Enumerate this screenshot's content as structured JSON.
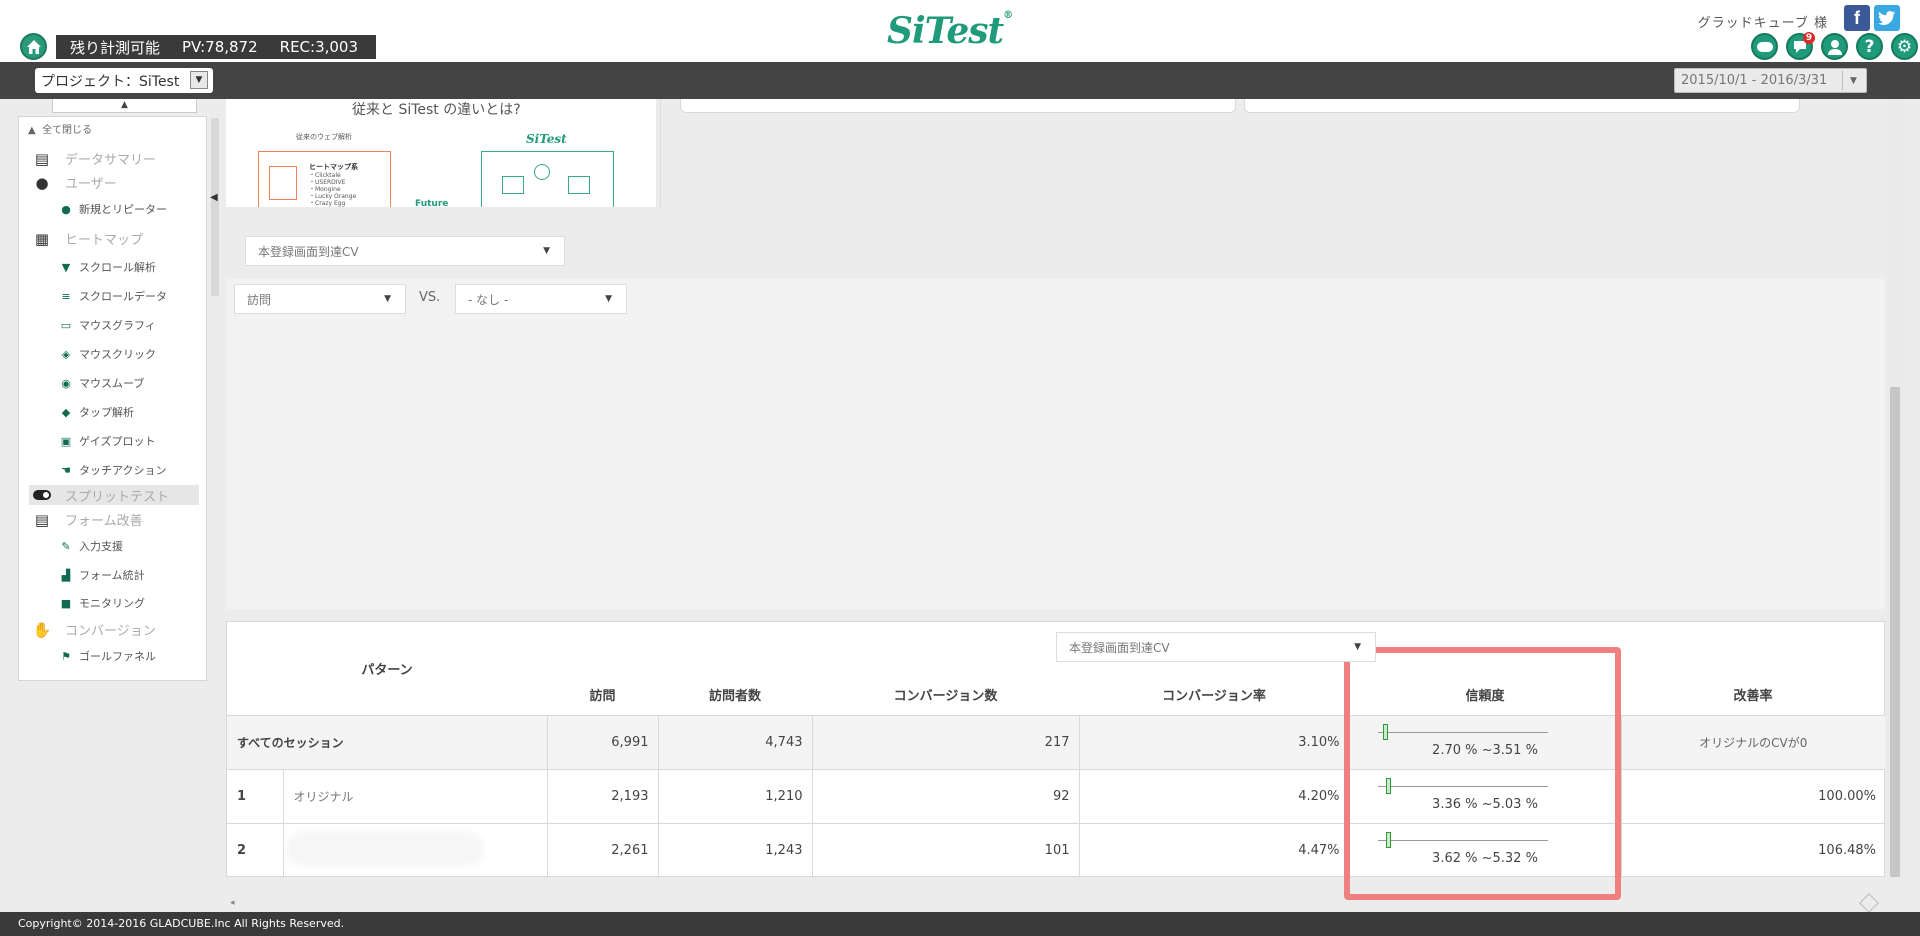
{
  "header": {
    "stats_label": "残り計測可能",
    "pv": "PV:78,872",
    "rec": "REC:3,003",
    "logo": "SiTest",
    "user": "グラッドキューブ 様",
    "notification_count": "9"
  },
  "toolbar": {
    "project": "プロジェクト：SiTest",
    "date_range": "2015/10/1 - 2016/3/31"
  },
  "sidebar": {
    "collapse_all": "全て閉じる",
    "items": [
      {
        "label": "データサマリー",
        "icon": "clipboard-icon"
      },
      {
        "label": "ユーザー",
        "icon": "user-icon"
      },
      {
        "label": "新規とリピーター",
        "icon": "user-add-icon"
      },
      {
        "label": "ヒートマップ",
        "icon": "heatmap-icon"
      },
      {
        "label": "スクロール解析",
        "icon": "scroll-icon"
      },
      {
        "label": "スクロールデータ",
        "icon": "list-icon"
      },
      {
        "label": "マウスグラフィ",
        "icon": "monitor-icon"
      },
      {
        "label": "マウスクリック",
        "icon": "click-icon"
      },
      {
        "label": "マウスムーブ",
        "icon": "mouse-icon"
      },
      {
        "label": "タップ解析",
        "icon": "tap-icon"
      },
      {
        "label": "ゲイズプロット",
        "icon": "gaze-icon"
      },
      {
        "label": "タッチアクション",
        "icon": "touch-icon"
      },
      {
        "label": "スプリットテスト",
        "icon": "toggle-icon"
      },
      {
        "label": "フォーム改善",
        "icon": "form-icon"
      },
      {
        "label": "入力支援",
        "icon": "input-icon"
      },
      {
        "label": "フォーム統計",
        "icon": "bar-chart-icon"
      },
      {
        "label": "モニタリング",
        "icon": "video-icon"
      },
      {
        "label": "コンバージョン",
        "icon": "handshake-icon"
      },
      {
        "label": "ゴールファネル",
        "icon": "flag-icon"
      }
    ]
  },
  "promo": {
    "title": "従来と SiTest の違いとは?",
    "left_caption": "従来のウェブ解析",
    "box_heading": "ヒートマップ系",
    "box_lines": [
      "・Clicktale",
      "・USERDIVE",
      "・Mongine",
      "・Lucky Orange",
      "・Crazy Egg"
    ],
    "future": "Future",
    "sitest": "SiTest"
  },
  "filters": {
    "cv_goal": "本登録画面到達CV",
    "metric": "訪問",
    "vs": "VS.",
    "compare": "- なし -"
  },
  "table": {
    "cv_goal": "本登録画面到達CV",
    "headers": {
      "pattern": "パターン",
      "visits": "訪問",
      "visitors": "訪問者数",
      "conversions": "コンバージョン数",
      "cvr": "コンバージョン率",
      "confidence": "信頼度",
      "improvement": "改善率"
    },
    "rows": [
      {
        "no": "",
        "name": "すべてのセッション",
        "visits": "6,991",
        "visitors": "4,743",
        "conversions": "217",
        "cvr": "3.10%",
        "conf": "2.70 % ~3.51 %",
        "conf_pos": 0.05,
        "improvement": "オリジナルのCVが0"
      },
      {
        "no": "1",
        "name": "オリジナル",
        "visits": "2,193",
        "visitors": "1,210",
        "conversions": "92",
        "cvr": "4.20%",
        "conf": "3.36 % ~5.03 %",
        "conf_pos": 0.07,
        "improvement": "100.00%"
      },
      {
        "no": "2",
        "name": "",
        "visits": "2,261",
        "visitors": "1,243",
        "conversions": "101",
        "cvr": "4.47%",
        "conf": "3.62 % ~5.32 %",
        "conf_pos": 0.07,
        "improvement": "106.48%"
      }
    ]
  },
  "footer": {
    "copyright": "Copyright© 2014-2016 GLADCUBE.Inc All Rights Reserved."
  }
}
